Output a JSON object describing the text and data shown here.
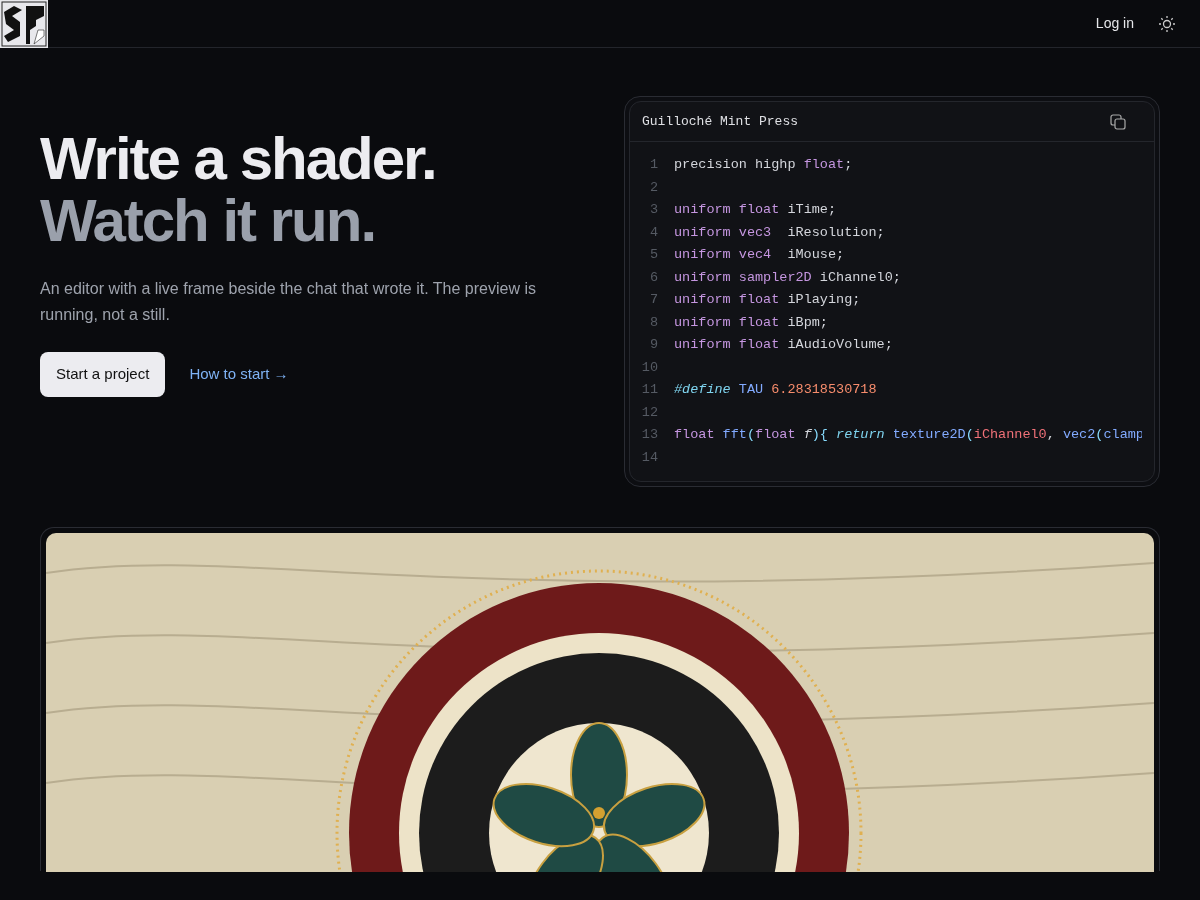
{
  "nav": {
    "login": "Log in"
  },
  "hero": {
    "title_lines": [
      "Write a shader.",
      "Watch it run."
    ],
    "lead": "An editor with a live frame beside the chat that wrote it. The preview is running, not a still.",
    "primary_button": "Start a project",
    "link": "How to start →"
  },
  "code_card": {
    "title": "Guilloché Mint Press",
    "lines": [
      {
        "number": "1",
        "tokens": [
          {
            "text": "precision highp ",
            "kind": "plain"
          },
          {
            "text": "float",
            "kind": "type"
          },
          {
            "text": ";",
            "kind": "plain"
          }
        ]
      },
      {
        "number": "2"
      },
      {
        "number": "3",
        "tokens": [
          {
            "text": "uniform float",
            "kind": "type"
          },
          {
            "text": " iTime;",
            "kind": "plain"
          }
        ]
      },
      {
        "number": "4",
        "tokens": [
          {
            "text": "uniform vec3",
            "kind": "type"
          },
          {
            "text": "  iResolution;",
            "kind": "plain"
          }
        ]
      },
      {
        "number": "5",
        "tokens": [
          {
            "text": "uniform vec4",
            "kind": "type"
          },
          {
            "text": "  iMouse;",
            "kind": "plain"
          }
        ]
      },
      {
        "number": "6",
        "tokens": [
          {
            "text": "uniform sampler2D",
            "kind": "type"
          },
          {
            "text": " iChannel0;",
            "kind": "plain"
          }
        ]
      },
      {
        "number": "7",
        "tokens": [
          {
            "text": "uniform float",
            "kind": "type"
          },
          {
            "text": " iPlaying;",
            "kind": "plain"
          }
        ]
      },
      {
        "number": "8",
        "tokens": [
          {
            "text": "uniform float",
            "kind": "type"
          },
          {
            "text": " iBpm;",
            "kind": "plain"
          }
        ]
      },
      {
        "number": "9",
        "tokens": [
          {
            "text": "uniform float",
            "kind": "type"
          },
          {
            "text": " iAudioVolume;",
            "kind": "plain"
          }
        ]
      },
      {
        "number": "10"
      },
      {
        "number": "11",
        "tokens": [
          {
            "text": "#define",
            "kind": "directive"
          },
          {
            "text": " TAU",
            "kind": "func"
          },
          {
            "text": " 6.28318530718",
            "kind": "number"
          }
        ]
      },
      {
        "number": "12"
      },
      {
        "number": "13",
        "tokens": [
          {
            "text": "float",
            "kind": "type"
          },
          {
            "text": " fft",
            "kind": "func"
          },
          {
            "text": "(",
            "kind": "punct"
          },
          {
            "text": "float",
            "kind": "type"
          },
          {
            "text": " f",
            "kind": "param"
          },
          {
            "text": "){ ",
            "kind": "punct"
          },
          {
            "text": "return",
            "kind": "directive"
          },
          {
            "text": " texture2D",
            "kind": "func"
          },
          {
            "text": "(",
            "kind": "punct"
          },
          {
            "text": "iChannel0",
            "kind": "variable"
          },
          {
            "text": ", ",
            "kind": "plain"
          },
          {
            "text": "vec2",
            "kind": "func"
          },
          {
            "text": "(",
            "kind": "punct"
          },
          {
            "text": "clamp",
            "kind": "func"
          }
        ]
      },
      {
        "number": "14"
      }
    ]
  }
}
